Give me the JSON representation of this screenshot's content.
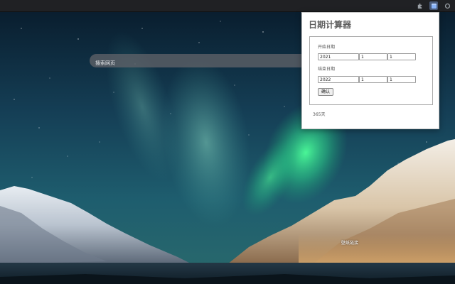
{
  "toolbar": {
    "icons": [
      "puzzle-icon",
      "calendar-icon",
      "menu-icon"
    ],
    "active_color": "#4a5b7a"
  },
  "search": {
    "placeholder": "搜索网页",
    "value": ""
  },
  "bottom_link": {
    "label": "壁纸链接"
  },
  "popup": {
    "title": "日期计算器",
    "start": {
      "label": "开始日期",
      "year": "2021",
      "month": "1",
      "day": "1"
    },
    "end": {
      "label": "结束日期",
      "year": "2022",
      "month": "1",
      "day": "1"
    },
    "confirm_label": "确认",
    "result": "365天"
  }
}
